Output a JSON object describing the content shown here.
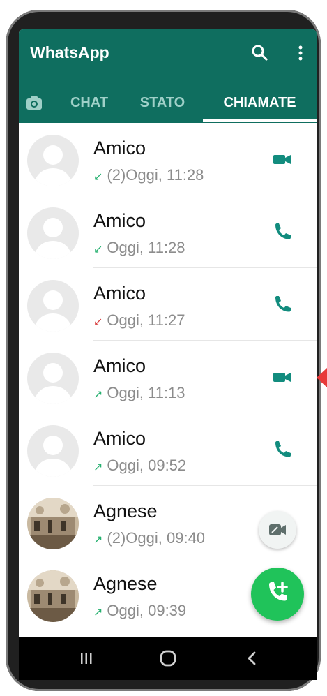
{
  "app": {
    "title": "WhatsApp"
  },
  "tabs": [
    {
      "label": "CHAT"
    },
    {
      "label": "STATO"
    },
    {
      "label": "CHIAMATE"
    }
  ],
  "calls": [
    {
      "name": "Amico",
      "direction": "incoming",
      "arrow": "↙",
      "arrow_color": "#25b06f",
      "count": "(2)",
      "time": "Oggi, 11:28",
      "type": "video",
      "avatar": "default"
    },
    {
      "name": "Amico",
      "direction": "incoming",
      "arrow": "↙",
      "arrow_color": "#25b06f",
      "count": "",
      "time": "Oggi, 11:28",
      "type": "voice",
      "avatar": "default"
    },
    {
      "name": "Amico",
      "direction": "missed",
      "arrow": "↙",
      "arrow_color": "#d93d3d",
      "count": "",
      "time": "Oggi, 11:27",
      "type": "voice",
      "avatar": "default"
    },
    {
      "name": "Amico",
      "direction": "outgoing",
      "arrow": "↗",
      "arrow_color": "#25b06f",
      "count": "",
      "time": "Oggi, 11:13",
      "type": "video",
      "avatar": "default"
    },
    {
      "name": "Amico",
      "direction": "outgoing",
      "arrow": "↗",
      "arrow_color": "#25b06f",
      "count": "",
      "time": "Oggi, 09:52",
      "type": "voice",
      "avatar": "default"
    },
    {
      "name": "Agnese",
      "direction": "outgoing",
      "arrow": "↗",
      "arrow_color": "#25b06f",
      "count": "(2)",
      "time": "Oggi, 09:40",
      "type": "voice",
      "avatar": "photo"
    },
    {
      "name": "Agnese",
      "direction": "outgoing",
      "arrow": "↗",
      "arrow_color": "#25b06f",
      "count": "",
      "time": "Oggi, 09:39",
      "type": "voice",
      "avatar": "photo"
    }
  ],
  "icons": {
    "search": "search-icon",
    "menu": "more-vert-icon",
    "camera": "camera-icon",
    "video": "videocam-icon",
    "voice": "phone-icon",
    "fab_video": "video-call-icon",
    "fab_call": "add-call-icon"
  },
  "colors": {
    "header": "#0f6e5f",
    "accent": "#128c7e",
    "fab": "#20c35a",
    "missed": "#d93d3d"
  }
}
